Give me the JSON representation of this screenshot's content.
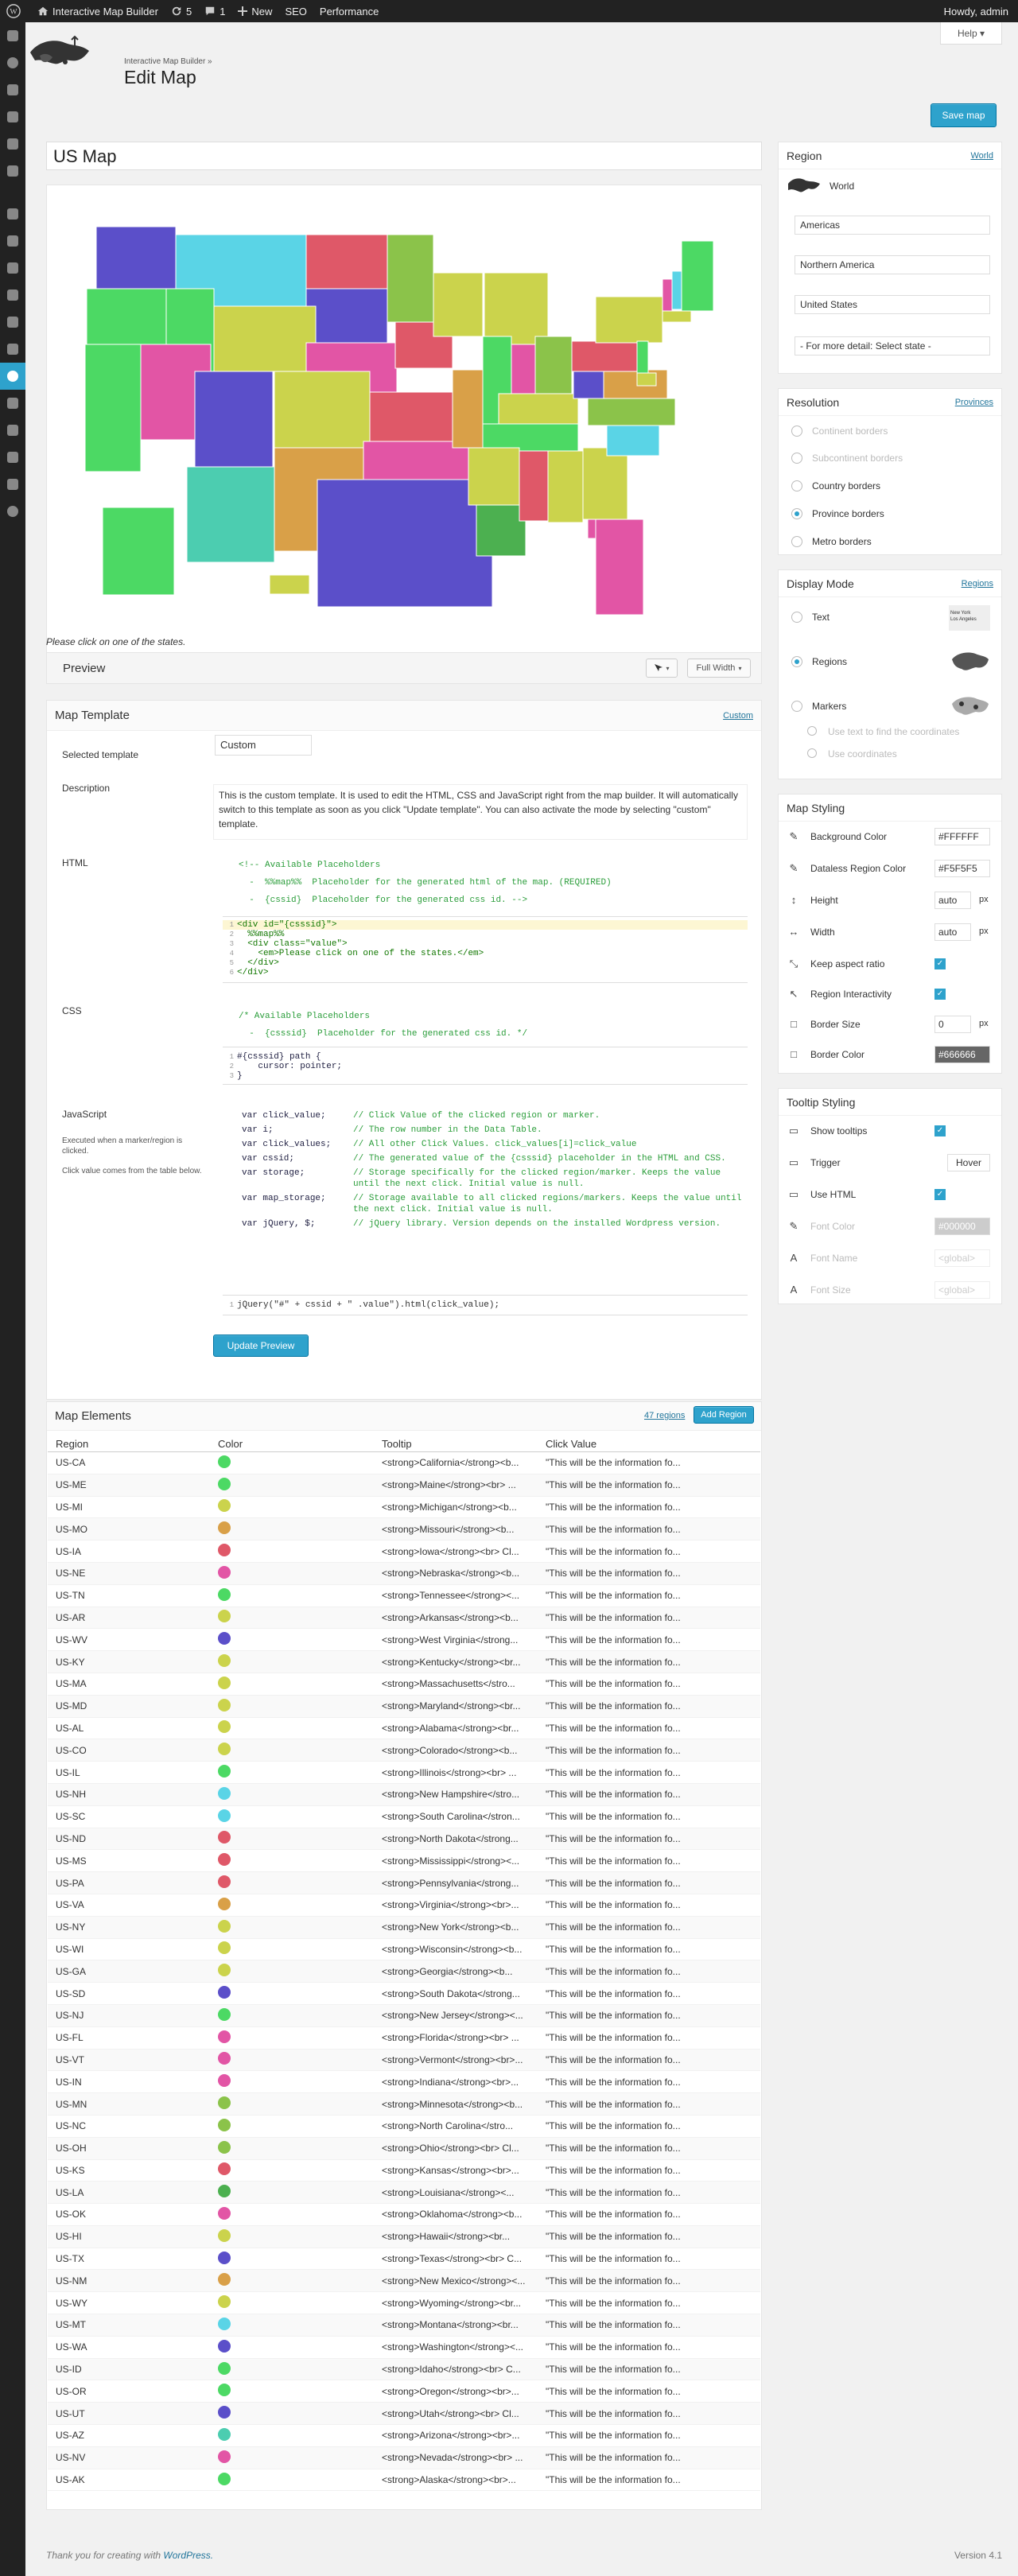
{
  "admin_bar": {
    "site_name": "Interactive Map Builder",
    "updates_count": "5",
    "comments_count": "1",
    "new_label": "New",
    "seo_label": "SEO",
    "performance_label": "Performance",
    "greeting": "Howdy, admin"
  },
  "header": {
    "help_label": "Help ▾",
    "breadcrumb": "Interactive Map Builder »",
    "title": "Edit Map",
    "save_label": "Save map"
  },
  "map": {
    "title": "US Map",
    "info_text": "Please click on one of the states.",
    "preview_label": "Preview",
    "full_width_label": "Full Width"
  },
  "template": {
    "heading": "Map Template",
    "custom_link": "Custom",
    "selected_label": "Selected template",
    "selected_value": "Custom",
    "description_label": "Description",
    "description": "This is the custom template. It is used to edit the HTML, CSS and JavaScript right from the map builder. It will automatically switch to this template as soon as you click \"Update template\". You can also activate the mode by selecting \"custom\" template.",
    "html_label": "HTML",
    "html_comment_1": "<!-- Available Placeholders",
    "html_comment_2": "  -  %%map%%  Placeholder for the generated html of the map. (REQUIRED)",
    "html_comment_3": "  -  {cssid}  Placeholder for the generated css id. -->",
    "html_code": [
      "<div id=\"{csssid}\">",
      "  %%map%%",
      "  <div class=\"value\">",
      "    <em>Please click on one of the states.</em>",
      "  </div>",
      "</div>"
    ],
    "css_label": "CSS",
    "css_comment_1": "/* Available Placeholders",
    "css_comment_2": "  -  {csssid}  Placeholder for the generated css id. */",
    "css_code": [
      "#{csssid} path {",
      "    cursor: pointer;",
      "}"
    ],
    "js_label": "JavaScript",
    "js_hint_1": "Executed when a marker/region is clicked.",
    "js_hint_2": "Click value comes from the table below.",
    "js_vars": [
      {
        "name": "var click_value;",
        "desc": "// Click Value of the clicked region or marker."
      },
      {
        "name": "var i;",
        "desc": "// The row number in the Data Table."
      },
      {
        "name": "var click_values;",
        "desc": "// All other Click Values. click_values[i]=click_value"
      },
      {
        "name": "var cssid;",
        "desc": "// The generated value of the {csssid} placeholder in the HTML and CSS."
      },
      {
        "name": "var storage;",
        "desc": "// Storage specifically for the clicked region/marker. Keeps the value until the next click. Initial value is null."
      },
      {
        "name": "var map_storage;",
        "desc": "// Storage available to all clicked regions/markers. Keeps the value until the next click. Initial value is null."
      },
      {
        "name": "var jQuery, $;",
        "desc": "// jQuery library. Version depends on the installed Wordpress version."
      }
    ],
    "js_code": "jQuery(\"#\" + cssid + \" .value\").html(click_value);",
    "update_label": "Update Preview"
  },
  "elements": {
    "heading": "Map Elements",
    "count_link": "47 regions",
    "add_label": "Add Region",
    "columns": [
      "Region",
      "Color",
      "Tooltip",
      "Click Value"
    ],
    "click_value": "\"This will be the information fo...",
    "rows": [
      {
        "region": "US-CA",
        "color": "#4cd964",
        "tip": "<strong>California</strong><b..."
      },
      {
        "region": "US-ME",
        "color": "#4cd964",
        "tip": "<strong>Maine</strong><br> ..."
      },
      {
        "region": "US-MI",
        "color": "#cbd34c",
        "tip": "<strong>Michigan</strong><b..."
      },
      {
        "region": "US-MO",
        "color": "#d9a048",
        "tip": "<strong>Missouri</strong><b..."
      },
      {
        "region": "US-IA",
        "color": "#df5868",
        "tip": "<strong>Iowa</strong><br> Cl..."
      },
      {
        "region": "US-NE",
        "color": "#e255a5",
        "tip": "<strong>Nebraska</strong><b..."
      },
      {
        "region": "US-TN",
        "color": "#4cd964",
        "tip": "<strong>Tennessee</strong><..."
      },
      {
        "region": "US-AR",
        "color": "#cbd34c",
        "tip": "<strong>Arkansas</strong><b..."
      },
      {
        "region": "US-WV",
        "color": "#5b4fc9",
        "tip": "<strong>West Virginia</strong..."
      },
      {
        "region": "US-KY",
        "color": "#cbd34c",
        "tip": "<strong>Kentucky</strong><br..."
      },
      {
        "region": "US-MA",
        "color": "#cbd34c",
        "tip": "<strong>Massachusetts</stro..."
      },
      {
        "region": "US-MD",
        "color": "#cbd34c",
        "tip": "<strong>Maryland</strong><br..."
      },
      {
        "region": "US-AL",
        "color": "#cbd34c",
        "tip": "<strong>Alabama</strong><br..."
      },
      {
        "region": "US-CO",
        "color": "#cbd34c",
        "tip": "<strong>Colorado</strong><b..."
      },
      {
        "region": "US-IL",
        "color": "#4cd964",
        "tip": "<strong>Illinois</strong><br> ..."
      },
      {
        "region": "US-NH",
        "color": "#5ad4e6",
        "tip": "<strong>New Hampshire</stro..."
      },
      {
        "region": "US-SC",
        "color": "#5ad4e6",
        "tip": "<strong>South Carolina</stron..."
      },
      {
        "region": "US-ND",
        "color": "#df5868",
        "tip": "<strong>North Dakota</strong..."
      },
      {
        "region": "US-MS",
        "color": "#df5868",
        "tip": "<strong>Mississippi</strong><..."
      },
      {
        "region": "US-PA",
        "color": "#df5868",
        "tip": "<strong>Pennsylvania</strong..."
      },
      {
        "region": "US-VA",
        "color": "#d9a048",
        "tip": "<strong>Virginia</strong><br>..."
      },
      {
        "region": "US-NY",
        "color": "#cbd34c",
        "tip": "<strong>New York</strong><b..."
      },
      {
        "region": "US-WI",
        "color": "#cbd34c",
        "tip": "<strong>Wisconsin</strong><b..."
      },
      {
        "region": "US-GA",
        "color": "#cbd34c",
        "tip": "<strong>Georgia</strong><b..."
      },
      {
        "region": "US-SD",
        "color": "#5b4fc9",
        "tip": "<strong>South Dakota</strong..."
      },
      {
        "region": "US-NJ",
        "color": "#4cd964",
        "tip": "<strong>New Jersey</strong><..."
      },
      {
        "region": "US-FL",
        "color": "#e255a5",
        "tip": "<strong>Florida</strong><br> ..."
      },
      {
        "region": "US-VT",
        "color": "#e255a5",
        "tip": "<strong>Vermont</strong><br>..."
      },
      {
        "region": "US-IN",
        "color": "#e255a5",
        "tip": "<strong>Indiana</strong><br>..."
      },
      {
        "region": "US-MN",
        "color": "#8bc34a",
        "tip": "<strong>Minnesota</strong><b..."
      },
      {
        "region": "US-NC",
        "color": "#8bc34a",
        "tip": "<strong>North Carolina</stro..."
      },
      {
        "region": "US-OH",
        "color": "#8bc34a",
        "tip": "<strong>Ohio</strong><br> Cl..."
      },
      {
        "region": "US-KS",
        "color": "#df5868",
        "tip": "<strong>Kansas</strong><br>..."
      },
      {
        "region": "US-LA",
        "color": "#4cb050",
        "tip": "<strong>Louisiana</strong><..."
      },
      {
        "region": "US-OK",
        "color": "#e255a5",
        "tip": "<strong>Oklahoma</strong><b..."
      },
      {
        "region": "US-HI",
        "color": "#cbd34c",
        "tip": "<strong>Hawaii</strong><br..."
      },
      {
        "region": "US-TX",
        "color": "#5b4fc9",
        "tip": "<strong>Texas</strong><br> C..."
      },
      {
        "region": "US-NM",
        "color": "#d9a048",
        "tip": "<strong>New Mexico</strong><..."
      },
      {
        "region": "US-WY",
        "color": "#cbd34c",
        "tip": "<strong>Wyoming</strong><br..."
      },
      {
        "region": "US-MT",
        "color": "#5ad4e6",
        "tip": "<strong>Montana</strong><br..."
      },
      {
        "region": "US-WA",
        "color": "#5b4fc9",
        "tip": "<strong>Washington</strong><..."
      },
      {
        "region": "US-ID",
        "color": "#4cd964",
        "tip": "<strong>Idaho</strong><br> C..."
      },
      {
        "region": "US-OR",
        "color": "#4cd964",
        "tip": "<strong>Oregon</strong><br>..."
      },
      {
        "region": "US-UT",
        "color": "#5b4fc9",
        "tip": "<strong>Utah</strong><br> Cl..."
      },
      {
        "region": "US-AZ",
        "color": "#4ccdb0",
        "tip": "<strong>Arizona</strong><br>..."
      },
      {
        "region": "US-NV",
        "color": "#e255a5",
        "tip": "<strong>Nevada</strong><br> ..."
      },
      {
        "region": "US-AK",
        "color": "#4cd964",
        "tip": "<strong>Alaska</strong><br>..."
      }
    ]
  },
  "region_panel": {
    "heading": "Region",
    "link": "World",
    "world_label": "World",
    "level_1": "Americas",
    "level_2": "Northern America",
    "level_3": "United States",
    "level_4": "- For more detail: Select state -"
  },
  "resolution_panel": {
    "heading": "Resolution",
    "link": "Provinces",
    "options": [
      "Continent borders",
      "Subcontinent borders",
      "Country borders",
      "Province borders",
      "Metro borders"
    ]
  },
  "display_panel": {
    "heading": "Display Mode",
    "link": "Regions",
    "options": [
      "Text",
      "Regions",
      "Markers"
    ],
    "sub_1": "Use text to find the coordinates",
    "sub_2": "Use coordinates",
    "thumb_text": "New York\nLos Angeles"
  },
  "styling_panel": {
    "heading": "Map Styling",
    "bg_label": "Background Color",
    "bg_value": "#FFFFFF",
    "dataless_label": "Dataless Region Color",
    "dataless_value": "#F5F5F5",
    "height_label": "Height",
    "height_value": "auto",
    "width_label": "Width",
    "width_value": "auto",
    "px": "px",
    "aspect_label": "Keep aspect ratio",
    "interactivity_label": "Region Interactivity",
    "border_size_label": "Border Size",
    "border_size_value": "0",
    "border_color_label": "Border Color",
    "border_color_value": "#666666"
  },
  "tooltip_panel": {
    "heading": "Tooltip Styling",
    "show_label": "Show tooltips",
    "trigger_label": "Trigger",
    "trigger_value": "Hover",
    "html_label": "Use HTML",
    "font_color_label": "Font Color",
    "font_color_value": "#000000",
    "font_name_label": "Font Name",
    "font_name_value": "<global>",
    "font_size_label": "Font Size",
    "font_size_value": "<global>"
  },
  "footer": {
    "thanks": "Thank you for creating with",
    "wp_link": "WordPress.",
    "version": "Version 4.1"
  }
}
